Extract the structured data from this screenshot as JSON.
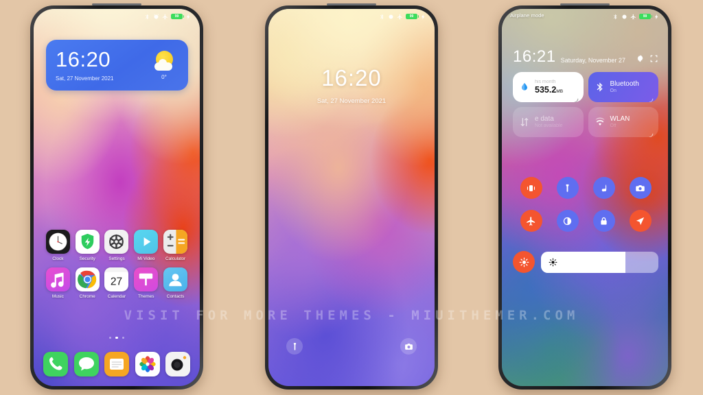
{
  "background_color": "#e3c6a7",
  "watermark": "VISIT FOR MORE THEMES - MIUITHEMER.COM",
  "status_bar": {
    "icons": [
      "bluetooth-icon",
      "alarm-icon",
      "airplane-icon",
      "battery-icon",
      "charging-icon"
    ],
    "battery_level": "99"
  },
  "phone_home": {
    "name": "Home screen",
    "widget": {
      "time": "16:20",
      "date": "Sat, 27 November 2021",
      "temperature": "0°",
      "weather_icon": "sun-cloud-icon",
      "bg_color": "#4a7bf0"
    },
    "apps_row1": [
      {
        "label": "Clock",
        "icon": "clock-icon"
      },
      {
        "label": "Security",
        "icon": "security-shield-icon"
      },
      {
        "label": "Settings",
        "icon": "settings-gear-icon"
      },
      {
        "label": "Mi Video",
        "icon": "mi-video-icon"
      },
      {
        "label": "Calculator",
        "icon": "calculator-icon"
      }
    ],
    "apps_row2": [
      {
        "label": "Music",
        "icon": "music-note-icon"
      },
      {
        "label": "Chrome",
        "icon": "chrome-icon"
      },
      {
        "label": "Calendar",
        "icon": "calendar-icon",
        "day": "27"
      },
      {
        "label": "Themes",
        "icon": "themes-icon"
      },
      {
        "label": "Contacts",
        "icon": "contacts-icon"
      }
    ],
    "page_dots": {
      "count": 3,
      "active_index": 1
    },
    "dock": [
      {
        "label": "Phone",
        "icon": "phone-icon"
      },
      {
        "label": "Messages",
        "icon": "messages-icon"
      },
      {
        "label": "Notes",
        "icon": "notes-icon"
      },
      {
        "label": "Gallery",
        "icon": "gallery-icon"
      },
      {
        "label": "Camera",
        "icon": "camera-icon"
      }
    ]
  },
  "phone_lock": {
    "name": "Lock screen",
    "time": "16:20",
    "date": "Sat, 27 November 2021",
    "shortcut_left": "flashlight-icon",
    "shortcut_right": "camera-icon"
  },
  "phone_control": {
    "name": "Control center",
    "status_label": "Airplane mode",
    "time": "16:21",
    "date": "Saturday, November 27",
    "header_icons": [
      "settings-gear-icon",
      "screenshot-icon"
    ],
    "tiles": [
      {
        "name": "data-usage",
        "sub": "his month",
        "main": "535.2",
        "unit": "MB",
        "icon": "water-drop-icon",
        "style": "white"
      },
      {
        "name": "bluetooth",
        "main": "Bluetooth",
        "sub": "On",
        "icon": "bluetooth-icon",
        "style": "blue"
      },
      {
        "name": "mobile-data",
        "main": "e data",
        "sub": "Not available",
        "icon": "data-transfer-icon",
        "style": "dim"
      },
      {
        "name": "wlan",
        "main": "WLAN",
        "sub": "Off",
        "icon": "wifi-icon",
        "style": "dim"
      }
    ],
    "toggles": [
      {
        "name": "vibrate",
        "icon": "vibrate-icon",
        "color": "#f4552f"
      },
      {
        "name": "flashlight",
        "icon": "flashlight-icon",
        "color": "#5f6ef0"
      },
      {
        "name": "music",
        "icon": "music-note-icon",
        "color": "#5f6ef0"
      },
      {
        "name": "screen-record",
        "icon": "camera-icon",
        "color": "#5f6ef0"
      },
      {
        "name": "airplane-mode",
        "icon": "airplane-icon",
        "color": "#f4552f"
      },
      {
        "name": "dark-mode",
        "icon": "contrast-icon",
        "color": "#5f6ef0"
      },
      {
        "name": "lock",
        "icon": "lock-icon",
        "color": "#5f6ef0"
      },
      {
        "name": "location",
        "icon": "location-arrow-icon",
        "color": "#f4552f"
      }
    ],
    "brightness": {
      "icon": "brightness-icon",
      "toggle_color": "#f4552f",
      "value_percent": 72
    }
  }
}
